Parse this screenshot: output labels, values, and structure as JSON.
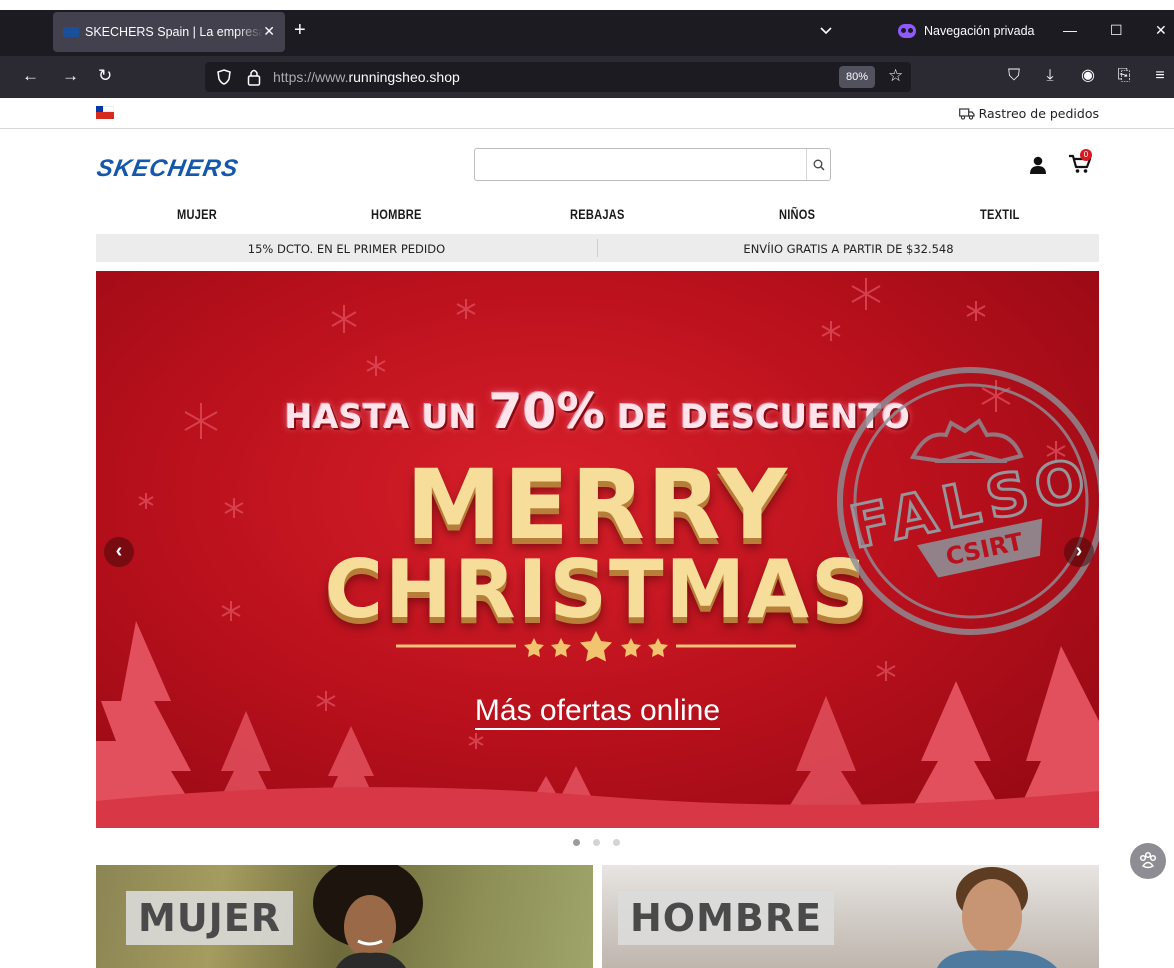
{
  "browser": {
    "tab_title": "SKECHERS Spain | La empresa d",
    "new_tab_symbol": "+",
    "private_label": "Navegación privada",
    "url_prefix": "https://www.",
    "url_domain": "runningsheo.shop",
    "zoom": "80%"
  },
  "utility": {
    "tracking_label": "Rastreo de pedidos"
  },
  "header": {
    "logo_text": "SKECHERS",
    "search_placeholder": "",
    "cart_count": "0"
  },
  "nav": {
    "items": [
      "MUJER",
      "HOMBRE",
      "REBAJAS",
      "NIÑOS",
      "TEXTIL"
    ]
  },
  "promo": {
    "left": "15% DCTO. EN EL PRIMER PEDIDO",
    "right": "ENVÍIO GRATIS A PARTIR DE $32.548"
  },
  "hero": {
    "headline_pre": "HASTA UN ",
    "headline_pct": "70%",
    "headline_post": " DE DESCUENTO",
    "line1": "MERRY",
    "line2": "CHRISTMAS",
    "cta": "Más ofertas online",
    "stamp_text": "FALSO",
    "stamp_sub": "CSIRT",
    "slides": 3,
    "active_slide": 1
  },
  "categories": {
    "women": "MUJER",
    "men": "HOMBRE"
  },
  "colors": {
    "brand_blue": "#1457ad",
    "hero_red": "#b8101c",
    "gold": "#f7dd9a",
    "stamp_gray": "#8e8e95",
    "chrome_dark": "#1c1b22",
    "private_purple": "#9059ff"
  },
  "icons": [
    "back-icon",
    "forward-icon",
    "reload-icon",
    "shield-icon",
    "lock-icon",
    "star-icon",
    "pocket-icon",
    "download-icon",
    "account-icon",
    "extensions-icon",
    "menu-icon",
    "truck-icon",
    "search-icon",
    "user-icon",
    "cart-icon",
    "chevron-left-icon",
    "chevron-right-icon",
    "paw-icon"
  ]
}
